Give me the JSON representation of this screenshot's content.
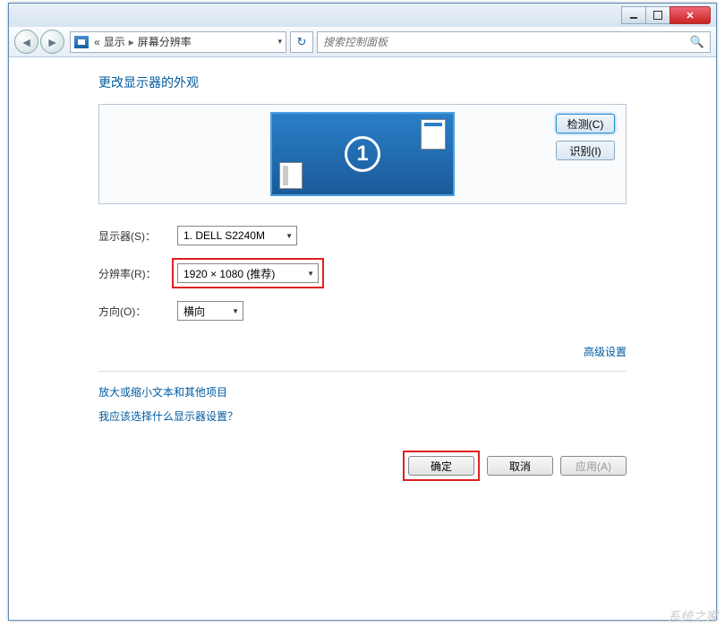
{
  "breadcrumb": {
    "back_marker": "«",
    "part1": "显示",
    "part2": "屏幕分辨率"
  },
  "search": {
    "placeholder": "搜索控制面板"
  },
  "page": {
    "title": "更改显示器的外观"
  },
  "monitor": {
    "number": "1"
  },
  "buttons": {
    "detect": "检测(C)",
    "identify": "识别(I)"
  },
  "fields": {
    "display_label": "显示器(S)：",
    "display_value": "1. DELL S2240M",
    "resolution_label": "分辨率(R)：",
    "resolution_value": "1920 × 1080 (推荐)",
    "orientation_label": "方向(O)：",
    "orientation_value": "横向"
  },
  "links": {
    "advanced": "高级设置",
    "text_size": "放大或缩小文本和其他项目",
    "which_settings": "我应该选择什么显示器设置？"
  },
  "actions": {
    "ok": "确定",
    "cancel": "取消",
    "apply": "应用(A)"
  },
  "watermark": "系统之家"
}
